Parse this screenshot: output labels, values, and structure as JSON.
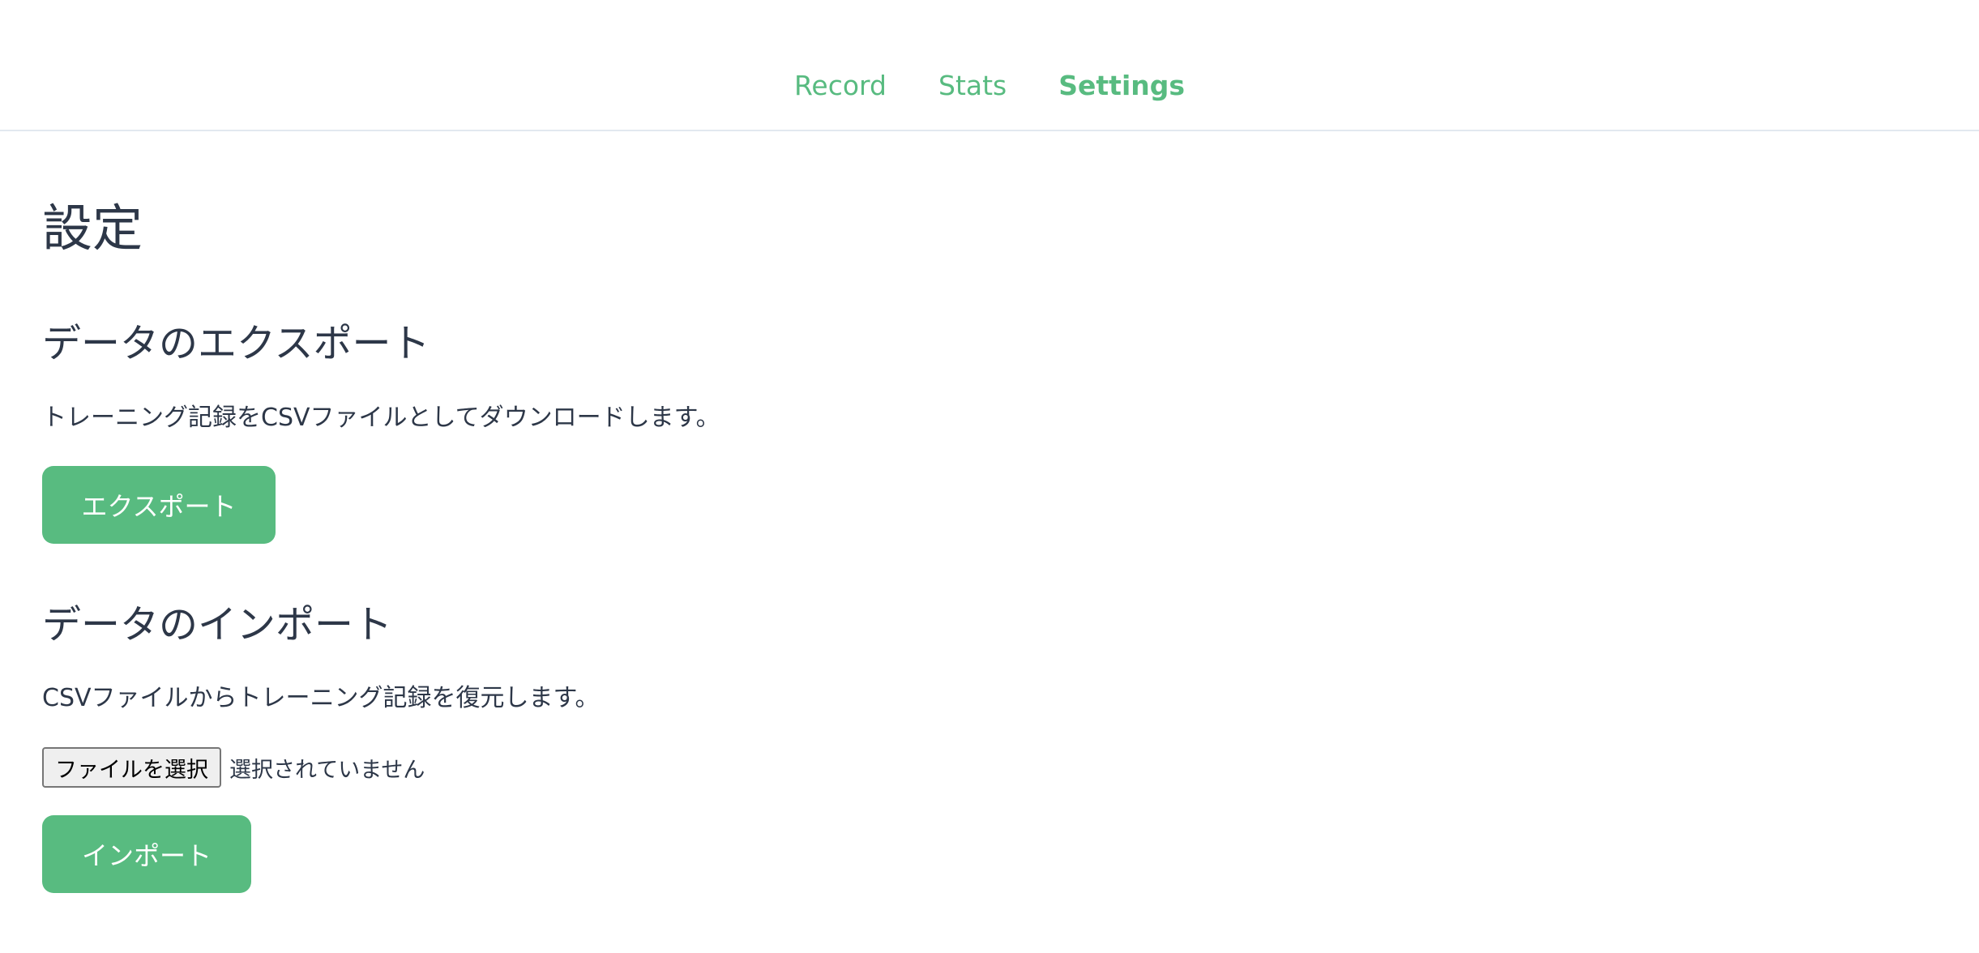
{
  "nav": {
    "record": "Record",
    "stats": "Stats",
    "settings": "Settings"
  },
  "page": {
    "title": "設定"
  },
  "export_section": {
    "title": "データのエクスポート",
    "description": "トレーニング記録をCSVファイルとしてダウンロードします。",
    "button_label": "エクスポート"
  },
  "import_section": {
    "title": "データのインポート",
    "description": "CSVファイルからトレーニング記録を復元します。",
    "file_button_label": "ファイルを選択",
    "file_status": "選択されていません",
    "button_label": "インポート"
  },
  "colors": {
    "accent": "#58bb80",
    "text": "#2d3748",
    "divider": "#e2e8f0"
  }
}
